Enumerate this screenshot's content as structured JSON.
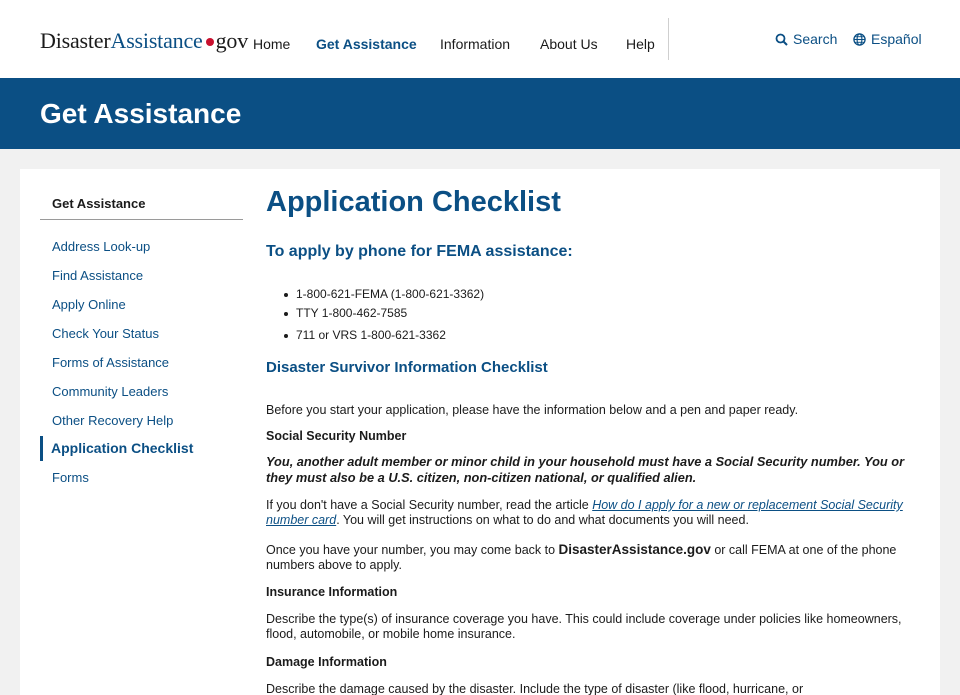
{
  "header": {
    "logo": {
      "part1": "Disaster",
      "part2": "Assistance",
      "part3": "gov"
    },
    "nav": [
      "Home",
      "Get Assistance",
      "Information",
      "About Us",
      "Help"
    ],
    "search_label": "Search",
    "language_label": "Español"
  },
  "banner": {
    "title": "Get Assistance"
  },
  "sidebar": {
    "title": "Get Assistance",
    "items": [
      "Address Look-up",
      "Find Assistance",
      "Apply Online",
      "Check Your Status",
      "Forms of Assistance",
      "Community Leaders",
      "Other Recovery Help",
      "Application Checklist",
      "Forms"
    ]
  },
  "main": {
    "title": "Application Checklist",
    "phone_heading": "To apply by phone for FEMA assistance:",
    "phones": [
      "1-800-621-FEMA (1-800-621-3362)",
      "TTY 1-800-462-7585",
      "711 or VRS 1-800-621-3362"
    ],
    "checklist_heading": "Disaster Survivor Information Checklist",
    "intro": "Before you start your application, please have the information below and a pen and paper ready.",
    "ssn": {
      "heading": "Social Security Number",
      "emphasis": "You, another adult member or minor child in your household must have a Social Security number. You or they must also be a U.S. citizen, non-citizen national, or qualified alien.",
      "p1_before": "If you don't have a Social Security number, read the article ",
      "p1_link": "How do I apply for a new or replacement Social Security number card",
      "p1_after": ". You will get instructions on what to do and what documents you will need.",
      "p2_before": "Once you have your number, you may come back to ",
      "p2_site": "DisasterAssistance.gov",
      "p2_after": " or call FEMA at one of the phone numbers above to apply."
    },
    "insurance": {
      "heading": "Insurance Information",
      "text": "Describe the type(s) of insurance coverage you have. This could include coverage under policies like homeowners, flood, automobile, or mobile home insurance."
    },
    "damage": {
      "heading": "Damage Information",
      "text": "Describe the damage caused by the disaster. Include the type of disaster (like flood, hurricane, or"
    }
  },
  "colors": {
    "brand_blue": "#0b4f84",
    "logo_dot": "#c8102e",
    "page_bg": "#f1f1f1"
  }
}
